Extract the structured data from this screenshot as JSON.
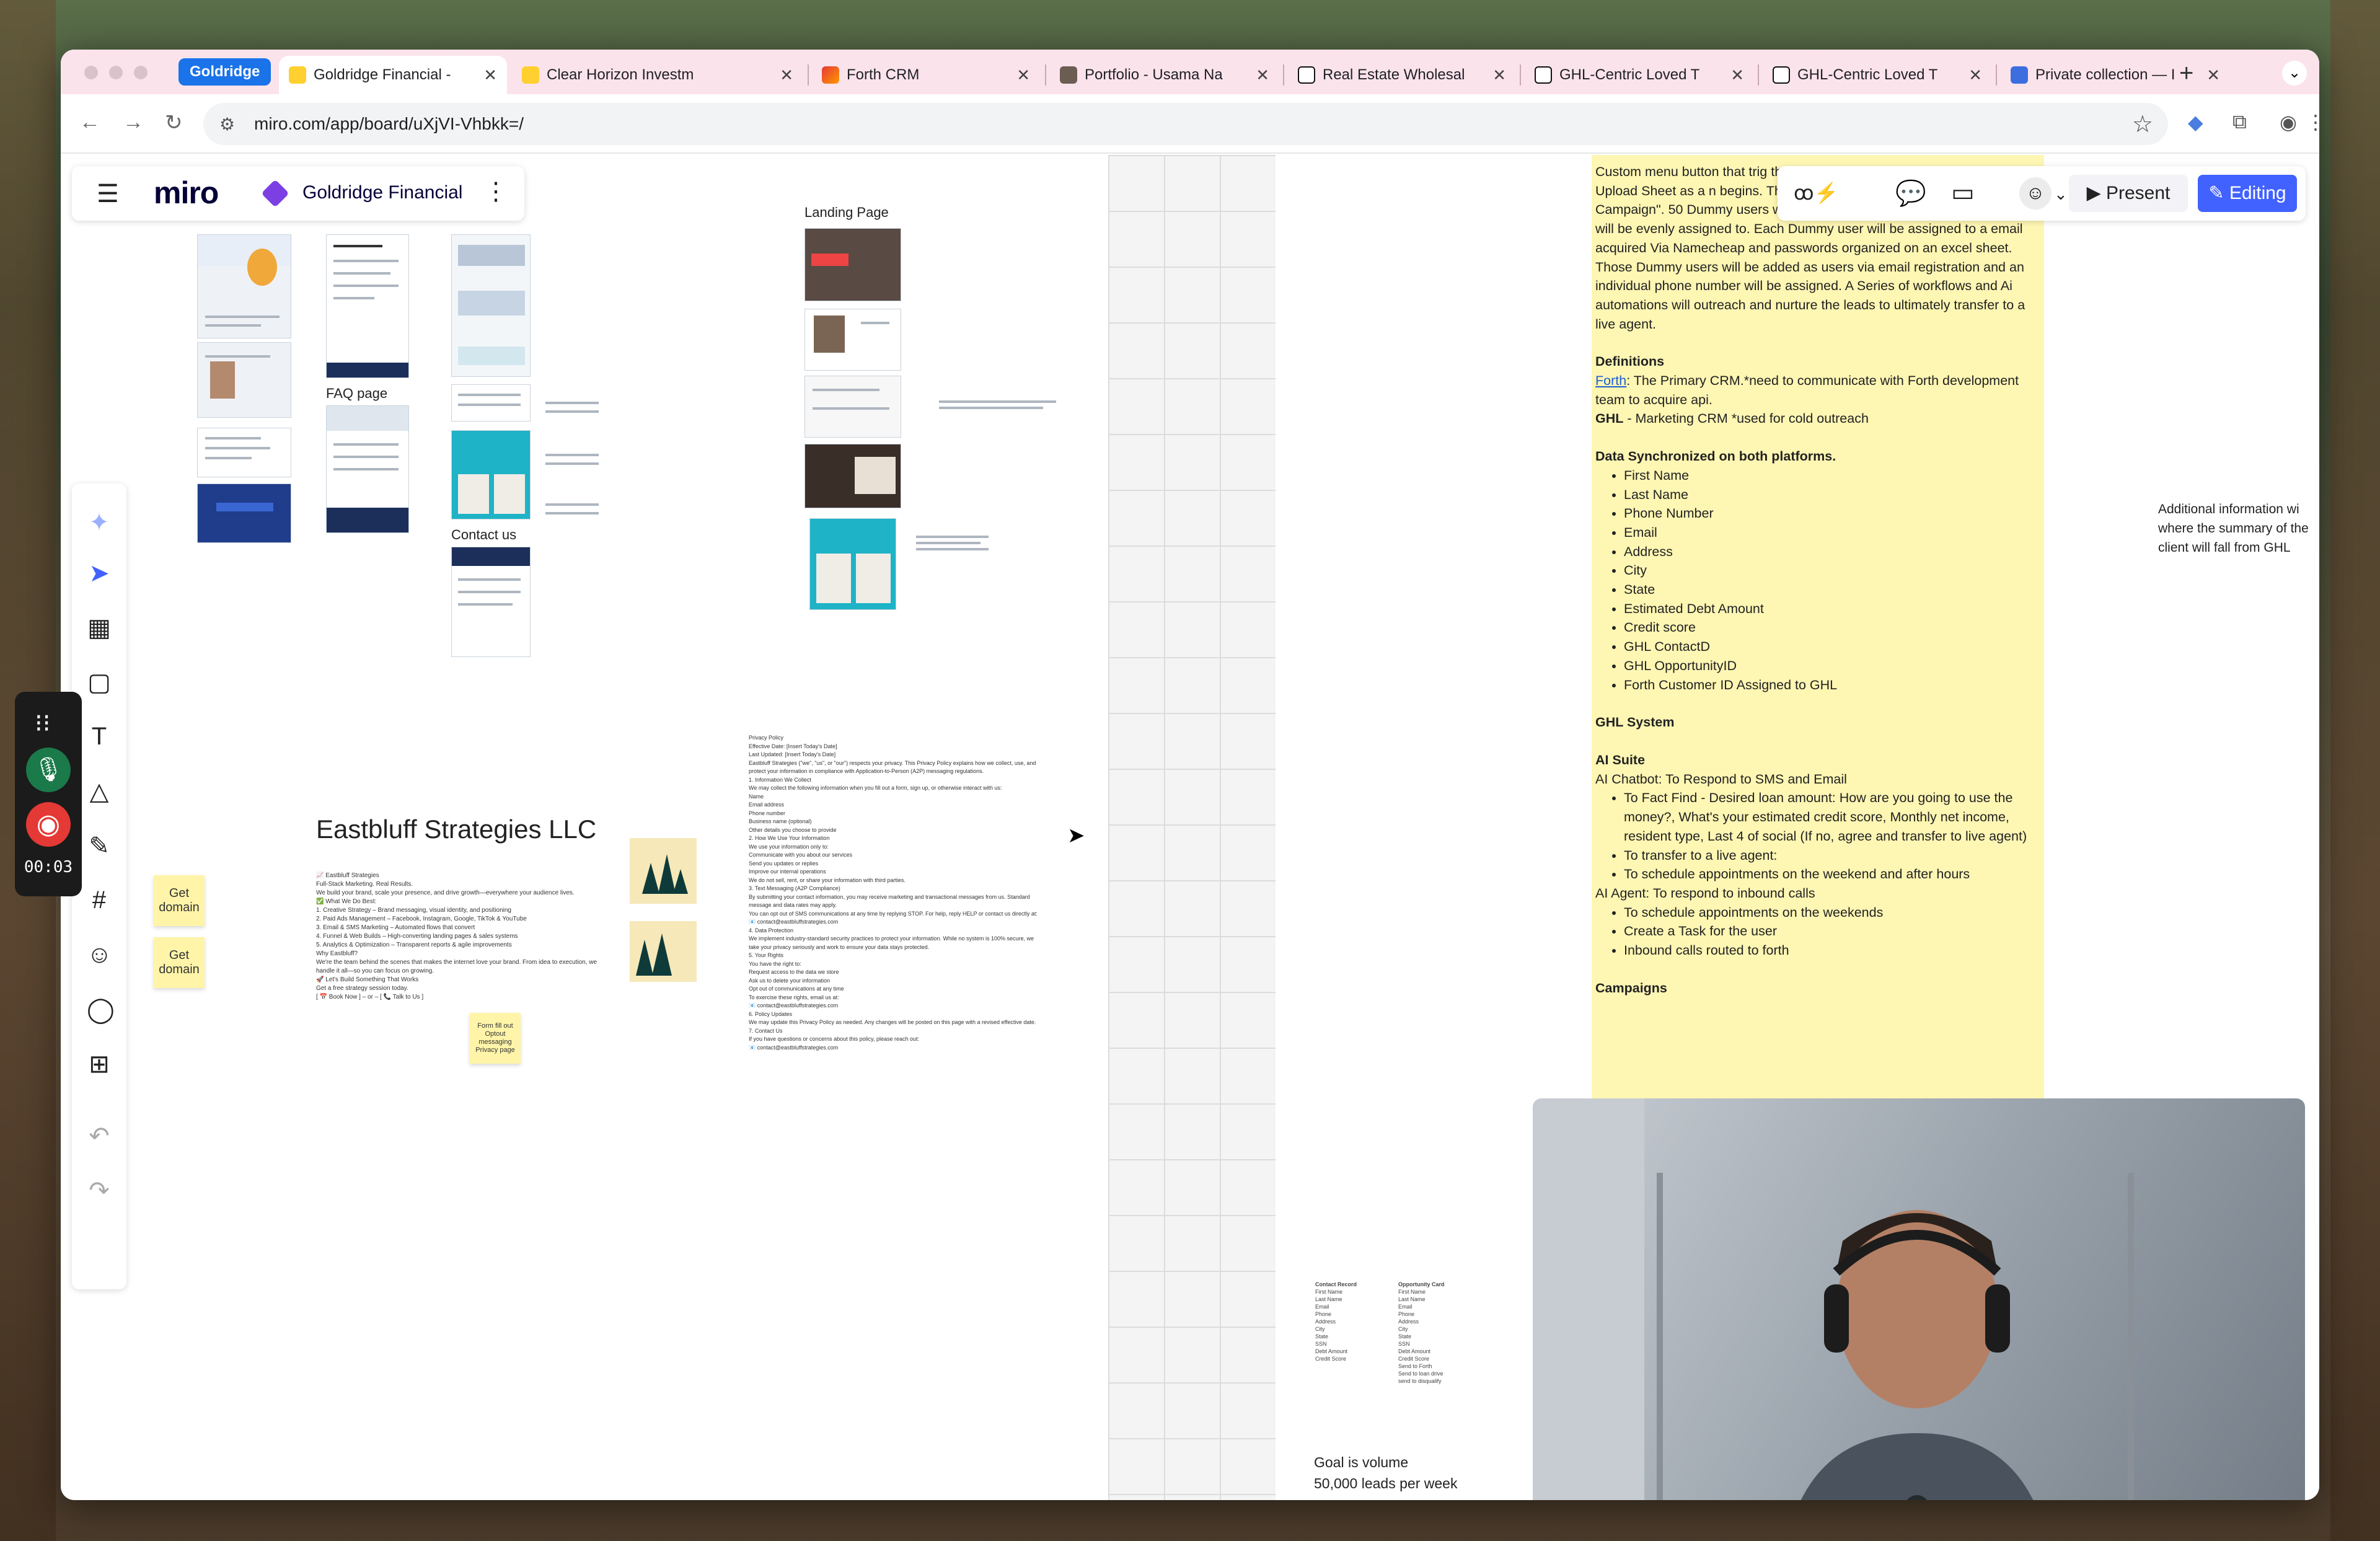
{
  "browser": {
    "tab_group": "Goldridge",
    "tabs": [
      {
        "label": "Goldridge Financial -",
        "active": true,
        "favicon": "miro-icon"
      },
      {
        "label": "Clear Horizon Investm",
        "active": false,
        "favicon": "miro-icon"
      },
      {
        "label": "Forth CRM",
        "active": false,
        "favicon": "forth-icon"
      },
      {
        "label": "Portfolio - Usama Na",
        "active": false,
        "favicon": "profile-icon"
      },
      {
        "label": "Real Estate Wholesal",
        "active": false,
        "favicon": "notion-icon"
      },
      {
        "label": "GHL-Centric Loved T",
        "active": false,
        "favicon": "notion-icon"
      },
      {
        "label": "GHL-Centric Loved T",
        "active": false,
        "favicon": "notion-icon"
      },
      {
        "label": "Private collection — I",
        "active": false,
        "favicon": "x-icon"
      }
    ],
    "url": "miro.com/app/board/uXjVI-Vhbkk=/"
  },
  "miro": {
    "logo": "miro",
    "board_name": "Goldridge Financial",
    "present_label": "Present",
    "editing_label": "Editing"
  },
  "recorder": {
    "time": "00:03"
  },
  "canvas": {
    "landing_page_label": "Landing Page",
    "faq_label": "FAQ page",
    "contact_label": "Contact us",
    "company_name": "Eastbluff Strategies LLC",
    "sticky_get_domain_1": "Get domain",
    "sticky_get_domain_2": "Get domain",
    "sticky_optout": "Form fill out Optout messaging Privacy page",
    "eastbluff_lines": [
      "📈 Eastbluff Strategies",
      "Full-Stack Marketing. Real Results.",
      "We build your brand, scale your presence, and drive growth—everywhere your audience lives.",
      "✅ What We Do Best:",
      "1. Creative Strategy – Brand messaging, visual identity, and positioning",
      "2. Paid Ads Management – Facebook, Instagram, Google, TikTok & YouTube",
      "3. Email & SMS Marketing – Automated flows that convert",
      "4. Funnel & Web Builds – High-converting landing pages & sales systems",
      "5. Analytics & Optimization – Transparent reports & agile improvements",
      "Why Eastbluff?",
      "We're the team behind the scenes that makes the internet love your brand. From idea to execution, we handle it all—so you can focus on growing.",
      "🚀 Let's Build Something That Works",
      "Get a free strategy session today.",
      "[ 📅 Book Now ] – or – [ 📞 Talk to Us ]"
    ],
    "privacy_lines": [
      "Privacy Policy",
      "Effective Date: [Insert Today's Date]",
      "Last Updated: [Insert Today's Date]",
      "Eastbluff Strategies (\"we\", \"us\", or \"our\") respects your privacy. This Privacy Policy explains how we collect, use, and protect your information in compliance with Application-to-Person (A2P) messaging regulations.",
      "1. Information We Collect",
      "We may collect the following information when you fill out a form, sign up, or otherwise interact with us:",
      "Name",
      "Email address",
      "Phone number",
      "Business name (optional)",
      "Other details you choose to provide",
      "2. How We Use Your Information",
      "We use your information only to:",
      "Communicate with you about our services",
      "Send you updates or replies",
      "Improve our internal operations",
      "We do not sell, rent, or share your information with third parties.",
      "3. Text Messaging (A2P Compliance)",
      "By submitting your contact information, you may receive marketing and transactional messages from us. Standard message and data rates may apply.",
      "You can opt out of SMS communications at any time by replying STOP. For help, reply HELP or contact us directly at:",
      "📧 contact@eastbluffstrategies.com",
      "4. Data Protection",
      "We implement industry-standard security practices to protect your information. While no system is 100% secure, we take your privacy seriously and work to ensure your data stays protected.",
      "5. Your Rights",
      "You have the right to:",
      "Request access to the data we store",
      "Ask us to delete your information",
      "Opt out of communications at any time",
      "To exercise these rights, email us at:",
      "📧 contact@eastbluffstrategies.com",
      "6. Policy Updates",
      "We may update this Privacy Policy as needed. Any changes will be posted on this page with a revised effective date.",
      "7. Contact Us",
      "If you have questions or concerns about this policy, please reach out:",
      "📧 contact@eastbluffstrategies.com"
    ],
    "contact_record_title": "Contact Record",
    "contact_record_fields": [
      "First Name",
      "Last Name",
      "Email",
      "Phone",
      "Address",
      "City",
      "State",
      "SSN",
      "Debt Amount",
      "Credit Score"
    ],
    "opportunity_card_title": "Opportunity Card",
    "opportunity_card_fields": [
      "First Name",
      "Last Name",
      "Email",
      "Phone",
      "Address",
      "City",
      "State",
      "SSN",
      "Debt Amount",
      "Credit Score",
      "Send to Forth",
      "Send to loan drive",
      "send to disqualify"
    ],
    "goal_line_1": "Goal is volume",
    "goal_line_2": "50,000 leads per week",
    "side_note": "Additional information wi where the summary of the client will fall from GHL"
  },
  "doc": {
    "intro": "Custom menu button that trig through a litigator API and sy inside the Upload Sheet as a n begins. The Leads will run through the \"Cold Outreach Campaign\". 50 Dummy users will be created within GHL, which the leads will be evenly assigned to. Each Dummy user will be assigned to a email acquired Via Namecheap and passwords organized on an excel sheet. Those Dummy users will be added as users via email registration and an individual phone number will be assigned. A Series of workflows and Ai automations will outreach and nurture the leads to ultimately transfer to a live agent.",
    "definitions_title": "Definitions",
    "forth_link": "Forth",
    "forth_def": ": The Primary CRM.*need to communicate with Forth development team to acquire api.",
    "ghl_bold": "GHL",
    "ghl_def": " - Marketing CRM *used for cold outreach",
    "sync_title": "Data Synchronized on both platforms.",
    "sync_items": [
      "First Name",
      "Last Name",
      "Phone Number",
      "Email",
      "Address",
      "City",
      "State",
      "Estimated Debt Amount",
      "Credit score",
      "GHL ContactD",
      "GHL OpportunityID",
      "Forth Customer ID Assigned to GHL"
    ],
    "ghl_system_title": "GHL System",
    "ai_suite_title": "AI Suite",
    "ai_chatbot": "AI Chatbot: To Respond to SMS and Email",
    "chatbot_items": [
      "To Fact Find - Desired loan amount: How are you going to use the money?, What's your estimated  credit score, Monthly net income, resident type, Last 4 of social (If no, agree and transfer to live agent)",
      "To transfer to a live agent:",
      "To schedule appointments on the weekend and after hours"
    ],
    "ai_agent": "AI Agent: To respond to inbound calls",
    "agent_items": [
      "To schedule appointments on the weekends",
      "Create a Task for the user",
      "Inbound calls routed to forth"
    ],
    "campaigns_title": "Campaigns"
  }
}
